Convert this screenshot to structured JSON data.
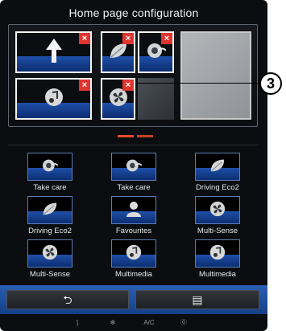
{
  "header": {
    "title": "Home page configuration"
  },
  "config_slots": [
    {
      "icon": "navigation-arrow-icon",
      "deletable": true
    },
    {
      "icon": "eco-leaf-icon",
      "deletable": true
    },
    {
      "icon": "care-icon",
      "deletable": true
    },
    {
      "icon": "empty",
      "deletable": false
    },
    {
      "icon": "music-note-icon",
      "deletable": true
    },
    {
      "icon": "fan-icon",
      "deletable": true
    }
  ],
  "delete_symbol": "×",
  "callout": {
    "number": "3"
  },
  "widgets": [
    {
      "label": "Take care",
      "icon": "care-icon"
    },
    {
      "label": "Take care",
      "icon": "care-icon"
    },
    {
      "label": "Driving Eco2",
      "icon": "eco-leaf-icon"
    },
    {
      "label": "Driving Eco2",
      "icon": "eco-leaf-icon"
    },
    {
      "label": "Favourites",
      "icon": "person-icon"
    },
    {
      "label": "Multi-Sense",
      "icon": "fan-icon"
    },
    {
      "label": "Multi-Sense",
      "icon": "fan-icon"
    },
    {
      "label": "Multimedia",
      "icon": "music-note-icon"
    },
    {
      "label": "Multimedia",
      "icon": "music-note-icon"
    }
  ],
  "toolbar": {
    "back_symbol": "⮌",
    "menu_symbol": "▤"
  },
  "status_bar": [
    {
      "icon": "seat-airflow-icon",
      "text": "⟆"
    },
    {
      "icon": "fan-icon",
      "text": "✻"
    },
    {
      "icon": "ac-icon",
      "text": "A/C"
    },
    {
      "icon": "auto-climate-icon",
      "text": "⓪"
    }
  ],
  "pager": {
    "pages": 2,
    "current": 1
  },
  "colors": {
    "accent": "#e54b2c",
    "band": "#1f4fa8",
    "delete": "#e0342f"
  }
}
